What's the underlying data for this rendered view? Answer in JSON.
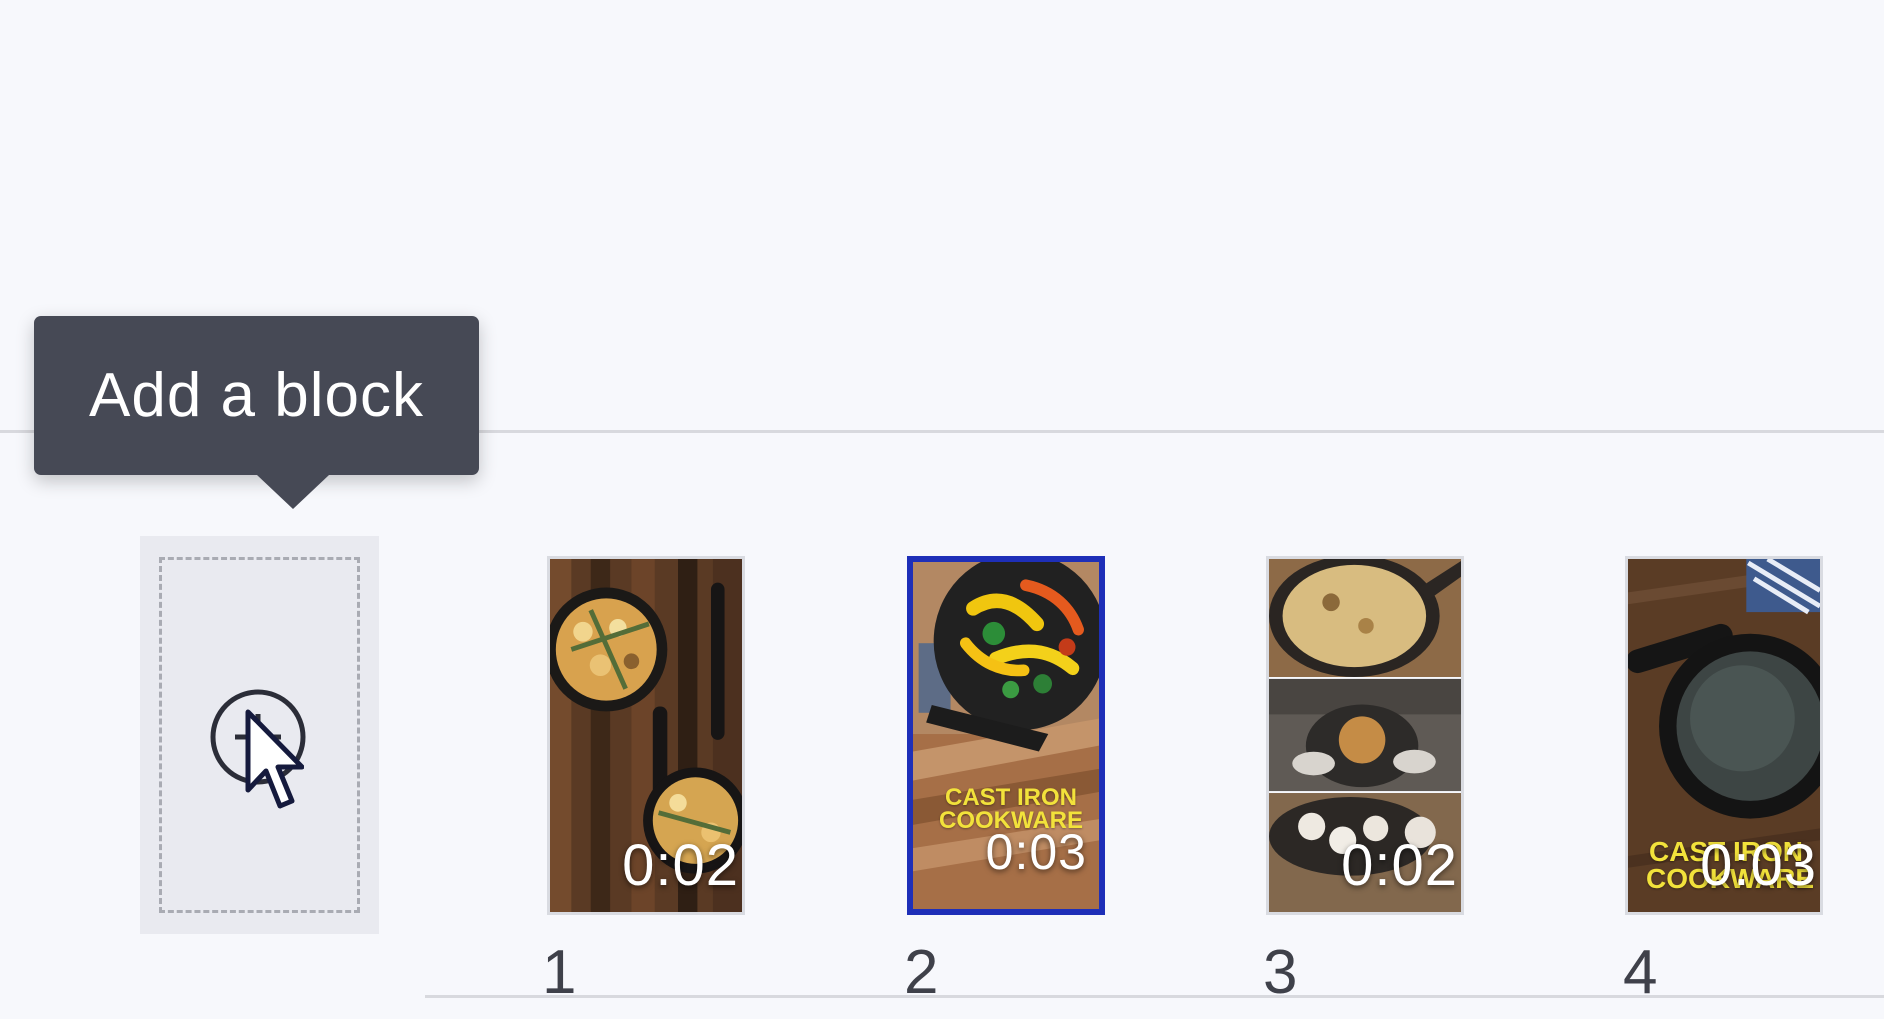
{
  "tooltip": {
    "text": "Add a block"
  },
  "blocks": [
    {
      "number": "1",
      "duration": "0:02",
      "thumbnail_icon": "frittata-skillets-image"
    },
    {
      "number": "2",
      "duration": "0:03",
      "thumbnail_icon": "peppers-skillet-image",
      "caption_line_1": "CAST IRON",
      "caption_line_2": "COOKWARE",
      "selected": true
    },
    {
      "number": "3",
      "duration": "0:02",
      "thumbnail_icon": "baked-skillets-collage-image"
    },
    {
      "number": "4",
      "duration": "0:03",
      "thumbnail_icon": "empty-skillet-image",
      "caption_line_1": "CAST IRON",
      "caption_line_2": "COOKWARE"
    }
  ],
  "colors": {
    "background": "#f7f8fc",
    "tooltip_background": "#464955",
    "selected_border": "#1e2fb8",
    "caption_yellow": "#f2e23b"
  }
}
